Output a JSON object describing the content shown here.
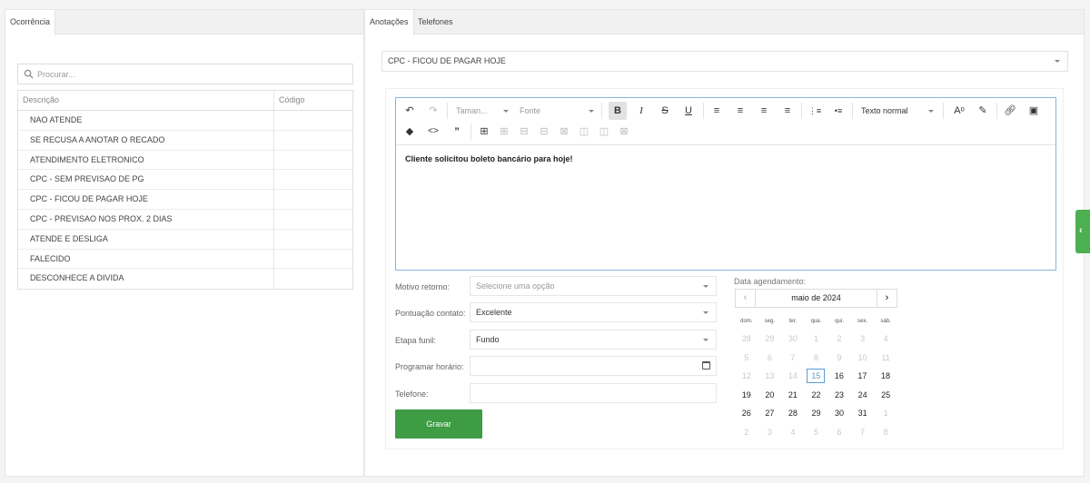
{
  "left_panel": {
    "tab": "Ocorrência",
    "search_placeholder": "Procurar...",
    "columns": [
      "Descrição",
      "Código"
    ],
    "rows": [
      {
        "descricao": "NAO ATENDE",
        "codigo": ""
      },
      {
        "descricao": "SE RECUSA A ANOTAR O RECADO",
        "codigo": ""
      },
      {
        "descricao": "ATENDIMENTO ELETRONICO",
        "codigo": ""
      },
      {
        "descricao": "CPC - SEM PREVISAO DE PG",
        "codigo": ""
      },
      {
        "descricao": "CPC - FICOU DE PAGAR HOJE",
        "codigo": ""
      },
      {
        "descricao": "CPC - PREVISAO NOS PROX. 2 DIAS",
        "codigo": ""
      },
      {
        "descricao": "ATENDE E DESLIGA",
        "codigo": ""
      },
      {
        "descricao": "FALECIDO",
        "codigo": ""
      },
      {
        "descricao": "DESCONHECE A DIVIDA",
        "codigo": ""
      }
    ]
  },
  "right_panel": {
    "tabs": [
      "Anotações",
      "Telefones"
    ],
    "selected_occurrence": "CPC - FICOU DE PAGAR HOJE",
    "editor": {
      "font_size_placeholder": "Taman...",
      "font_placeholder": "Fonte",
      "paragraph_style": "Texto normal",
      "content": "Cliente solicitou boleto bancário para hoje!"
    },
    "form": {
      "motivo_label": "Motivo retorno:",
      "motivo_placeholder": "Selecione uma opção",
      "pontuacao_label": "Pontuação contato:",
      "pontuacao_value": "Excelente",
      "etapa_label": "Etapa funil:",
      "etapa_value": "Fundo",
      "programar_label": "Programar horário:",
      "programar_value": "",
      "telefone_label": "Telefone:",
      "telefone_value": "",
      "submit_label": "Gravar"
    },
    "calendar": {
      "label": "Data agendamento:",
      "month": "maio de 2024",
      "weekdays": [
        "dom.",
        "seg.",
        "ter.",
        "qua.",
        "qui.",
        "sex.",
        "sáb."
      ],
      "weeks": [
        [
          [
            "28",
            true
          ],
          [
            "29",
            true
          ],
          [
            "30",
            true
          ],
          [
            "1",
            true
          ],
          [
            "2",
            true
          ],
          [
            "3",
            true
          ],
          [
            "4",
            true
          ]
        ],
        [
          [
            "5",
            true
          ],
          [
            "6",
            true
          ],
          [
            "7",
            true
          ],
          [
            "8",
            true
          ],
          [
            "9",
            true
          ],
          [
            "10",
            true
          ],
          [
            "11",
            true
          ]
        ],
        [
          [
            "12",
            true
          ],
          [
            "13",
            true
          ],
          [
            "14",
            true
          ],
          [
            "15",
            false,
            "today"
          ],
          [
            "16",
            false
          ],
          [
            "17",
            false
          ],
          [
            "18",
            false
          ]
        ],
        [
          [
            "19",
            false
          ],
          [
            "20",
            false
          ],
          [
            "21",
            false
          ],
          [
            "22",
            false
          ],
          [
            "23",
            false
          ],
          [
            "24",
            false
          ],
          [
            "25",
            false
          ]
        ],
        [
          [
            "26",
            false
          ],
          [
            "27",
            false
          ],
          [
            "28",
            false
          ],
          [
            "29",
            false
          ],
          [
            "30",
            false
          ],
          [
            "31",
            false
          ],
          [
            "1",
            true
          ]
        ],
        [
          [
            "2",
            true
          ],
          [
            "3",
            true
          ],
          [
            "4",
            true
          ],
          [
            "5",
            true
          ],
          [
            "6",
            true
          ],
          [
            "7",
            true
          ],
          [
            "8",
            true
          ]
        ]
      ]
    }
  },
  "colors": {
    "accent": "#3d9c44",
    "editor_border": "#89b6dc",
    "today": "#5b9bd5"
  }
}
